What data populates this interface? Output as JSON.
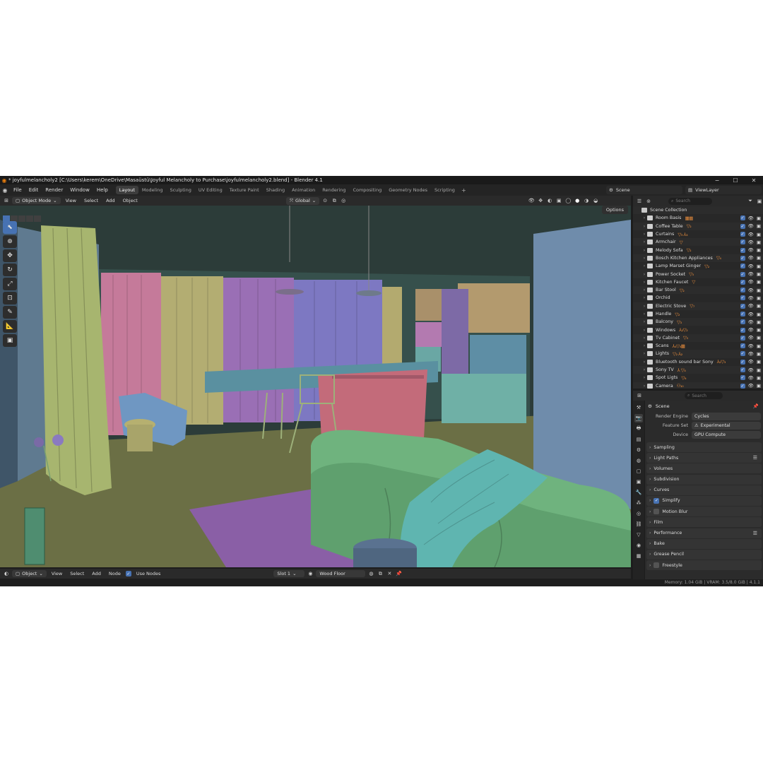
{
  "window": {
    "title": "* joyfulmelancholy2 [C:\\Users\\kerem\\OneDrive\\Masaüstü\\Joyful Melancholy to Purchase\\joyfulmelancholy2.blend] - Blender 4.1",
    "minimize": "−",
    "maximize": "☐",
    "close": "✕"
  },
  "menu": [
    "File",
    "Edit",
    "Render",
    "Window",
    "Help"
  ],
  "workspaces": [
    {
      "label": "Layout",
      "active": true
    },
    {
      "label": "Modeling"
    },
    {
      "label": "Sculpting"
    },
    {
      "label": "UV Editing"
    },
    {
      "label": "Texture Paint"
    },
    {
      "label": "Shading"
    },
    {
      "label": "Animation"
    },
    {
      "label": "Rendering"
    },
    {
      "label": "Compositing"
    },
    {
      "label": "Geometry Nodes"
    },
    {
      "label": "Scripting"
    }
  ],
  "scene_selector": "Scene",
  "viewlayer_selector": "ViewLayer",
  "viewport_header": {
    "mode": "Object Mode",
    "menus": [
      "View",
      "Select",
      "Add",
      "Object"
    ],
    "orientation": "Global",
    "options": "Options"
  },
  "node_header": {
    "type": "Object",
    "menus": [
      "View",
      "Select",
      "Add",
      "Node"
    ],
    "use_nodes": "Use Nodes",
    "slot": "Slot 1",
    "material": "Wood Floor"
  },
  "outliner": {
    "search_placeholder": "Search",
    "collection": "Scene Collection",
    "items": [
      {
        "name": "Room Basis",
        "tags": "▦▦"
      },
      {
        "name": "Coffee Table",
        "tags": "▽₂"
      },
      {
        "name": "Curtains",
        "tags": "▽₉ ⅄₃"
      },
      {
        "name": "Armchair",
        "tags": "▽"
      },
      {
        "name": "Melody Sofa",
        "tags": "▽₂"
      },
      {
        "name": "Bosch Kitchen Appliances",
        "tags": "▽₄"
      },
      {
        "name": "Lamp Marset Ginger",
        "tags": "▽₂"
      },
      {
        "name": "Power Socket",
        "tags": "▽₅"
      },
      {
        "name": "Kitchen Faucet",
        "tags": "▽"
      },
      {
        "name": "Bar Stool",
        "tags": "▽₂"
      },
      {
        "name": "Orchid",
        "tags": ""
      },
      {
        "name": "Electric Stove",
        "tags": "▽₇"
      },
      {
        "name": "Handle",
        "tags": "▽₂"
      },
      {
        "name": "Balcony",
        "tags": "▽₃"
      },
      {
        "name": "Windows",
        "tags": "⅄₂▽₂"
      },
      {
        "name": "Tv Cabinet",
        "tags": "▽₃"
      },
      {
        "name": "Scans",
        "tags": "⅄₄▽₄▦"
      },
      {
        "name": "Lights",
        "tags": "▽₂ ⅄₂"
      },
      {
        "name": "Bluetooth sound bar Sony",
        "tags": "⅄₂▽₃"
      },
      {
        "name": "Sony TV",
        "tags": "⅄ ▽₄"
      },
      {
        "name": "Spot Ligts",
        "tags": "▽₆"
      },
      {
        "name": "Camera",
        "tags": "⚇₁₀"
      }
    ]
  },
  "properties": {
    "search_placeholder": "Search",
    "context": "Scene",
    "render_engine_label": "Render Engine",
    "render_engine": "Cycles",
    "feature_set_label": "Feature Set",
    "feature_set": "Experimental",
    "device_label": "Device",
    "device": "GPU Compute",
    "panels": [
      {
        "label": "Sampling"
      },
      {
        "label": "Light Paths",
        "list": true
      },
      {
        "label": "Volumes"
      },
      {
        "label": "Subdivision"
      },
      {
        "label": "Curves"
      },
      {
        "label": "Simplify",
        "check": true
      },
      {
        "label": "Motion Blur",
        "check": false
      },
      {
        "label": "Film"
      },
      {
        "label": "Performance",
        "list": true
      },
      {
        "label": "Bake"
      },
      {
        "label": "Grease Pencil"
      },
      {
        "label": "Freestyle",
        "check": false
      }
    ]
  },
  "status": {
    "memory": "Memory: 1.04 GiB | VRAM: 3.5/8.0 GiB | 4.1.1"
  },
  "colors": {
    "accent": "#4772b3",
    "blender_orange": "#e87d0d",
    "curtain_green": "#a7b56f",
    "curtain_pink": "#c57a9a",
    "curtain_purple": "#9a6fb5",
    "sofa_green": "#6fb37e",
    "rug_purple": "#8a5fa6",
    "wall_blue": "#6f8cab"
  }
}
